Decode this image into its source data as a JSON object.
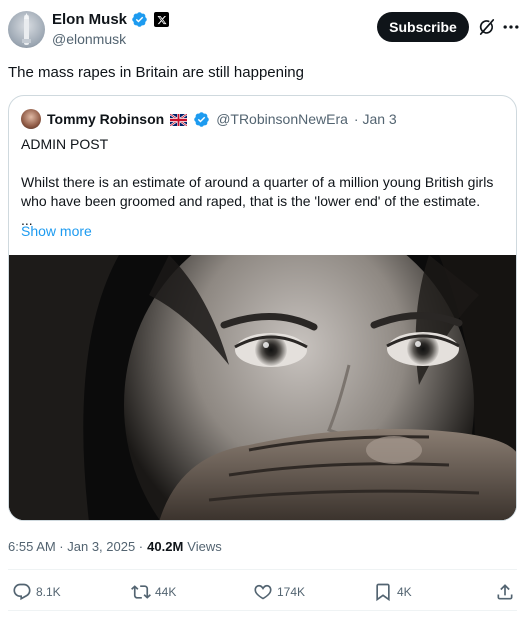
{
  "post": {
    "author": {
      "display_name": "Elon Musk",
      "handle": "@elonmusk",
      "verified": true,
      "affiliation_badge": "X"
    },
    "subscribe_label": "Subscribe",
    "text": "The mass rapes in Britain are still happening",
    "timestamp": "6:55 AM · Jan 3, 2025 ·",
    "views_count": "40.2M",
    "views_label": "Views"
  },
  "quote": {
    "display_name": "Tommy Robinson",
    "flag": "🇬🇧",
    "handle": "@TRobinsonNewEra",
    "date": "· Jan 3",
    "verified": true,
    "line1": "ADMIN POST",
    "line2": "Whilst there is an estimate of around a quarter of a million young British girls who have been groomed and raped, that is the 'lower end' of the estimate.",
    "line3": "...",
    "show_more": "Show more"
  },
  "actions": {
    "replies": "8.1K",
    "reposts": "44K",
    "likes": "174K",
    "bookmarks": "4K"
  },
  "icons": [
    "verified-badge-icon",
    "x-logo-icon",
    "grok-icon",
    "more-icon",
    "uk-flag-icon",
    "reply-icon",
    "repost-icon",
    "like-icon",
    "bookmark-icon",
    "share-icon"
  ],
  "colors": {
    "accent": "#1d9bf0",
    "text": "#0f1419",
    "secondary_text": "#536471",
    "border": "#cfd9de",
    "button_bg": "#0f1419"
  }
}
